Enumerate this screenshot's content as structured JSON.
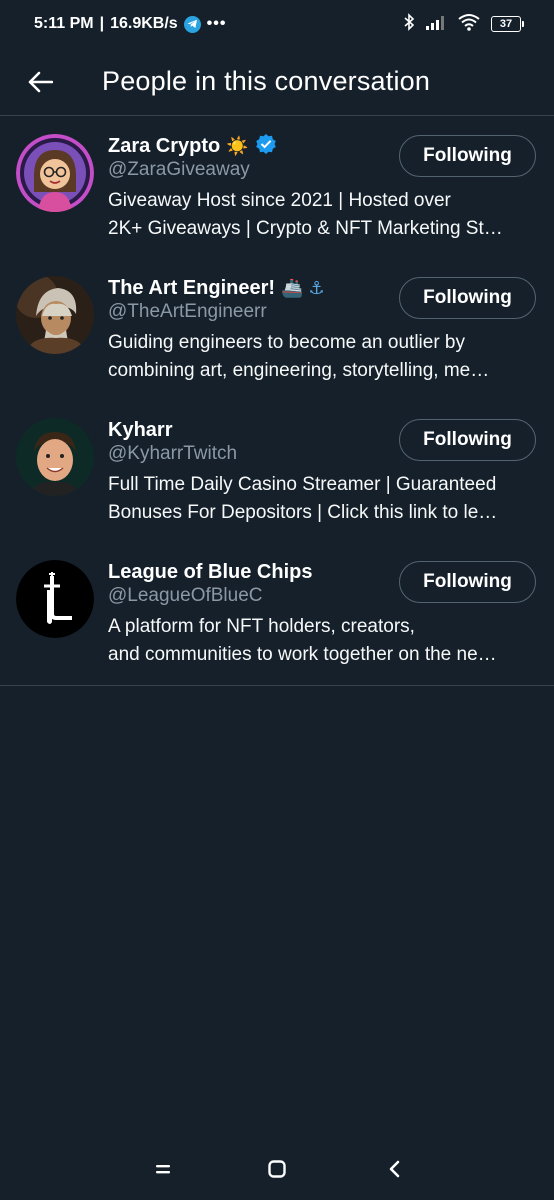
{
  "status_bar": {
    "time": "5:11 PM",
    "net_speed": "16.9KB/s",
    "separator": "|",
    "overflow": "•••",
    "battery": "37",
    "icons": [
      "telegram-icon",
      "bluetooth-icon",
      "signal-icon",
      "wifi-icon",
      "battery-icon"
    ]
  },
  "header": {
    "title": "People in this conversation",
    "back_icon": "arrow-left-icon"
  },
  "people": [
    {
      "name": "Zara Crypto",
      "emoji": "☀️",
      "verified": true,
      "handle": "@ZaraGiveaway",
      "bio_line1": "Giveaway Host since 2021 | Hosted over",
      "bio_line2": "2K+ Giveaways | Crypto & NFT Marketing St…",
      "button": "Following"
    },
    {
      "name": "The Art Engineer!",
      "emoji": "🚢 ⚓",
      "verified": false,
      "handle": "@TheArtEngineerr",
      "bio_line1": "Guiding engineers to become an outlier by",
      "bio_line2": "combining art, engineering, storytelling, me…",
      "button": "Following"
    },
    {
      "name": "Kyharr",
      "emoji": "",
      "verified": false,
      "handle": "@KyharrTwitch",
      "bio_line1": "Full Time Daily Casino Streamer | Guaranteed",
      "bio_line2": "Bonuses For Depositors | Click this link to le…",
      "button": "Following"
    },
    {
      "name": "League of Blue Chips",
      "emoji": "",
      "verified": false,
      "handle": "@LeagueOfBlueC",
      "bio_line1": "A platform for NFT holders, creators,",
      "bio_line2": "and communities to work together on the ne…",
      "button": "Following"
    }
  ],
  "colors": {
    "background": "#15202b",
    "divider": "#38444d",
    "secondary_text": "#8b98a5",
    "verified_blue": "#1d9bf0"
  },
  "nav_bar": {
    "icons": [
      "menu-icon",
      "home-square-icon",
      "back-chevron-icon"
    ]
  }
}
